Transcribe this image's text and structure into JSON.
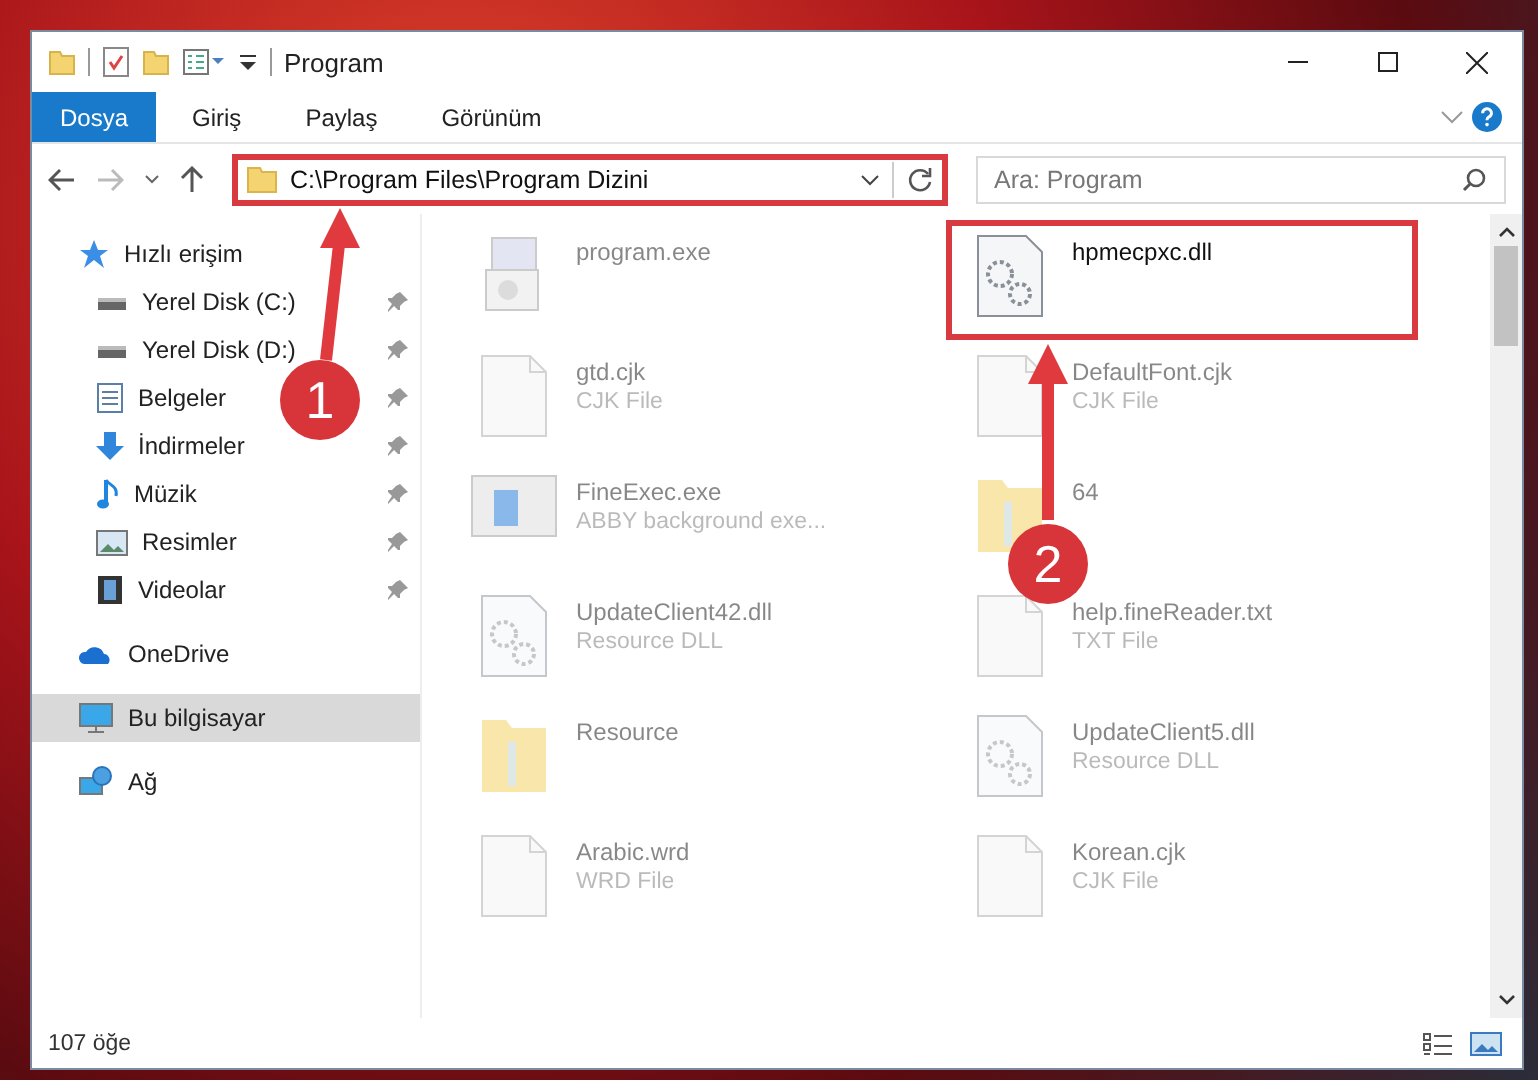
{
  "window": {
    "title": "Program"
  },
  "ribbon_tabs": [
    {
      "label": "Dosya",
      "selected": true
    },
    {
      "label": "Giriş",
      "selected": false
    },
    {
      "label": "Paylaş",
      "selected": false
    },
    {
      "label": "Görünüm",
      "selected": false
    }
  ],
  "address_bar": {
    "path": "C:\\Program Files\\Program Dizini",
    "highlighted": true
  },
  "search": {
    "placeholder": "Ara: Program"
  },
  "sidebar": {
    "items": [
      {
        "label": "Hızlı erişim",
        "kind": "star",
        "selected": false,
        "children": [
          {
            "label": "Yerel Disk (C:)",
            "kind": "drive",
            "pinned": true,
            "selected": false
          },
          {
            "label": "Yerel Disk (D:)",
            "kind": "drive",
            "pinned": true,
            "selected": false
          },
          {
            "label": "Belgeler",
            "kind": "documents",
            "pinned": true,
            "selected": false
          },
          {
            "label": "İndirmeler",
            "kind": "downloads",
            "pinned": true,
            "selected": false
          },
          {
            "label": "Müzik",
            "kind": "music",
            "pinned": true,
            "selected": false
          },
          {
            "label": "Resimler",
            "kind": "pictures",
            "pinned": true,
            "selected": false
          },
          {
            "label": "Videolar",
            "kind": "videos",
            "pinned": true,
            "selected": false
          }
        ]
      },
      {
        "label": "OneDrive",
        "kind": "cloud",
        "selected": false
      },
      {
        "label": "Bu bilgisayar",
        "kind": "computer",
        "selected": true
      },
      {
        "label": "Ağ",
        "kind": "network",
        "selected": false
      }
    ]
  },
  "files": [
    {
      "name": "program.exe",
      "kind": "installer",
      "dimmed": true,
      "highlighted": false
    },
    {
      "name": "hpmecpxc.dll",
      "kind": "dll",
      "dimmed": false,
      "highlighted": true
    },
    {
      "name": "gtd.cjk",
      "type": "CJK File",
      "kind": "blank",
      "dimmed": true,
      "highlighted": false
    },
    {
      "name": "DefaultFont.cjk",
      "type": "CJK File",
      "kind": "blank",
      "dimmed": true,
      "highlighted": false
    },
    {
      "name": "FineExec.exe",
      "type": "ABBY background exe...",
      "kind": "app",
      "dimmed": true,
      "highlighted": false
    },
    {
      "name": "64",
      "kind": "folder",
      "dimmed": true,
      "highlighted": false
    },
    {
      "name": "UpdateClient42.dll",
      "type": "Resource DLL",
      "kind": "dll",
      "dimmed": true,
      "highlighted": false
    },
    {
      "name": "help.fineReader.txt",
      "type": "TXT File",
      "kind": "text",
      "dimmed": true,
      "highlighted": false
    },
    {
      "name": "Resource",
      "kind": "folder",
      "dimmed": true,
      "highlighted": false
    },
    {
      "name": "UpdateClient5.dll",
      "type": "Resource DLL",
      "kind": "dll",
      "dimmed": true,
      "highlighted": false
    },
    {
      "name": "Arabic.wrd",
      "type": "WRD File",
      "kind": "blank",
      "dimmed": true,
      "highlighted": false
    },
    {
      "name": "Korean.cjk",
      "type": "CJK File",
      "kind": "blank",
      "dimmed": true,
      "highlighted": false
    }
  ],
  "annotations": [
    {
      "number": "1"
    },
    {
      "number": "2"
    }
  ],
  "status_bar": {
    "item_count": "107 öğe"
  }
}
